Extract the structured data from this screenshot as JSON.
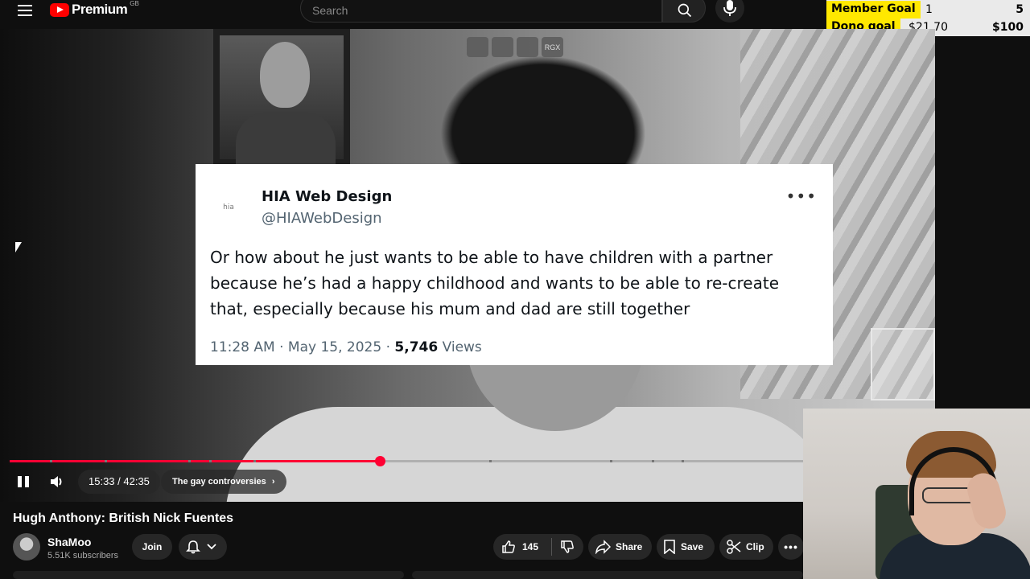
{
  "header": {
    "logo_text": "Premium",
    "region": "GB",
    "search_placeholder": "Search"
  },
  "goals": [
    {
      "label": "Member Goal",
      "current": "1",
      "target": "5"
    },
    {
      "label": "Dono goal",
      "current": "$21.70",
      "target": "$100"
    }
  ],
  "video": {
    "overlay_icons": [
      "",
      "",
      "",
      "RGX"
    ],
    "progress": 0.467,
    "time": "15:33 / 42:35",
    "chapter": "The gay controversies"
  },
  "tweet": {
    "name": "HIA Web Design",
    "handle": "@HIAWebDesign",
    "avatar_text": "hia",
    "text": "Or how about he just wants to be able to have children with a partner because he’s had a happy childhood and wants to be able to re-create that, especially because his mum and dad are still together",
    "time": "11:28 AM",
    "date": "May 15, 2025",
    "views_count": "5,746",
    "views_label": "Views"
  },
  "meta": {
    "title": "Hugh Anthony: British Nick Fuentes",
    "channel": "ShaMoo",
    "subscribers": "5.51K subscribers",
    "join_label": "Join",
    "likes": "145",
    "share_label": "Share",
    "save_label": "Save",
    "clip_label": "Clip"
  },
  "colors": {
    "accent": "#ff0033",
    "goal_highlight": "#ffe800"
  }
}
